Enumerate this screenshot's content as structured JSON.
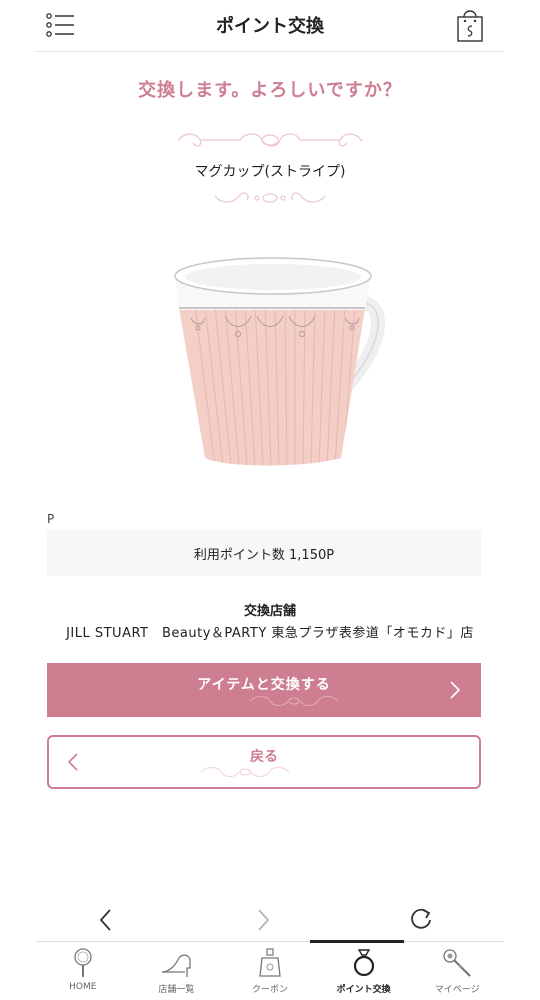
{
  "header": {
    "title": "ポイント交換",
    "menu_icon": "menu-list-icon",
    "bag_icon": "shopping-bag-icon"
  },
  "confirm_message": "交換します。よろしいですか？",
  "item": {
    "name": "マグカップ(ストライプ)",
    "image": "pink-striped-mug-image"
  },
  "points": {
    "prefix_label": "P",
    "usage_text": "利用ポイント数 1,150P"
  },
  "shop": {
    "title": "交換店舗",
    "name": "JILL STUART　Beauty＆PARTY 東急プラザ表参道「オモカド」店"
  },
  "buttons": {
    "exchange_label": "アイテムと交換する",
    "back_label": "戻る"
  },
  "browser_nav": {
    "back_icon": "chevron-left-icon",
    "forward_icon": "chevron-right-icon",
    "reload_icon": "reload-icon"
  },
  "tabs": [
    {
      "label": "HOME",
      "icon": "hand-mirror-icon",
      "active": false
    },
    {
      "label": "店舗一覧",
      "icon": "high-heel-icon",
      "active": false
    },
    {
      "label": "クーポン",
      "icon": "perfume-bottle-icon",
      "active": false
    },
    {
      "label": "ポイント交換",
      "icon": "ring-icon",
      "active": true
    },
    {
      "label": "マイページ",
      "icon": "wand-icon",
      "active": false
    }
  ],
  "colors": {
    "accent": "#cd7f91",
    "ornament": "#edc7cd",
    "text": "#222222",
    "points_bg": "#f7f7f7"
  }
}
